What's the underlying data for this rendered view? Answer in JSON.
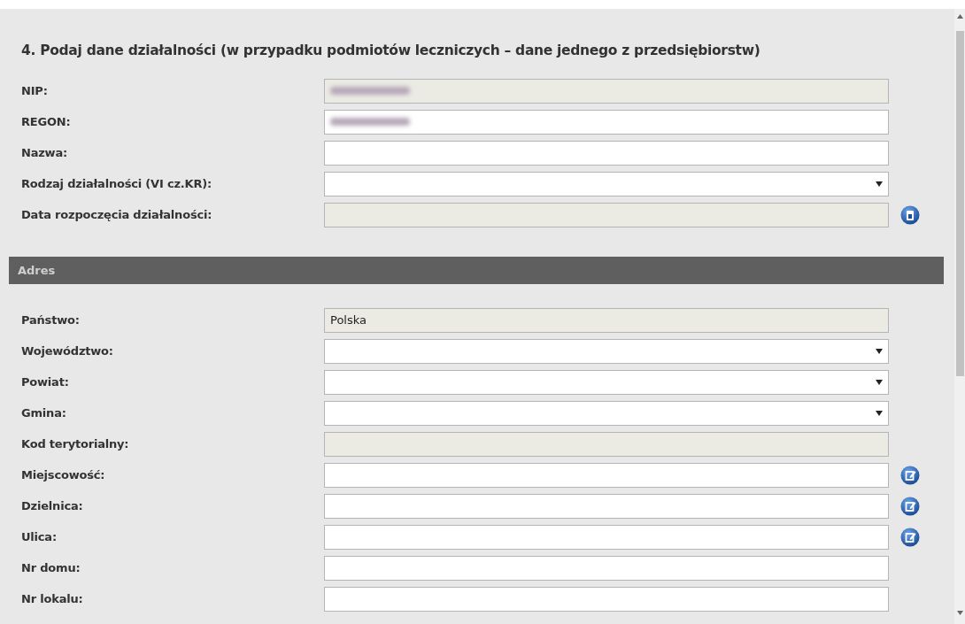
{
  "section_title": "4. Podaj dane działalności (w przypadku podmiotów leczniczych – dane jednego z przedsiębiorstw)",
  "fields": [
    {
      "label": "NIP:",
      "kind": "redacted",
      "disabled": true
    },
    {
      "label": "REGON:",
      "kind": "redacted",
      "disabled": false
    },
    {
      "label": "Nazwa:",
      "kind": "text",
      "disabled": false
    },
    {
      "label": "Rodzaj działalności (VI cz.KR):",
      "kind": "select",
      "disabled": false
    },
    {
      "label": "Data rozpoczęcia działalności:",
      "kind": "text",
      "disabled": true,
      "calendar_button": true
    }
  ],
  "address": {
    "title": "Adres",
    "fields": [
      {
        "label": "Państwo:",
        "kind": "text",
        "disabled": true,
        "value": "Polska"
      },
      {
        "label": "Województwo:",
        "kind": "select",
        "disabled": false
      },
      {
        "label": "Powiat:",
        "kind": "select",
        "disabled": false
      },
      {
        "label": "Gmina:",
        "kind": "select",
        "disabled": false
      },
      {
        "label": "Kod terytorialny:",
        "kind": "text",
        "disabled": true
      },
      {
        "label": "Miejscowość:",
        "kind": "text",
        "disabled": false,
        "edit_button": true
      },
      {
        "label": "Dzielnica:",
        "kind": "text",
        "disabled": false,
        "edit_button": true
      },
      {
        "label": "Ulica:",
        "kind": "text",
        "disabled": false,
        "edit_button": true
      },
      {
        "label": "Nr domu:",
        "kind": "text",
        "disabled": false
      },
      {
        "label": "Nr lokalu:",
        "kind": "text",
        "disabled": false
      }
    ]
  }
}
